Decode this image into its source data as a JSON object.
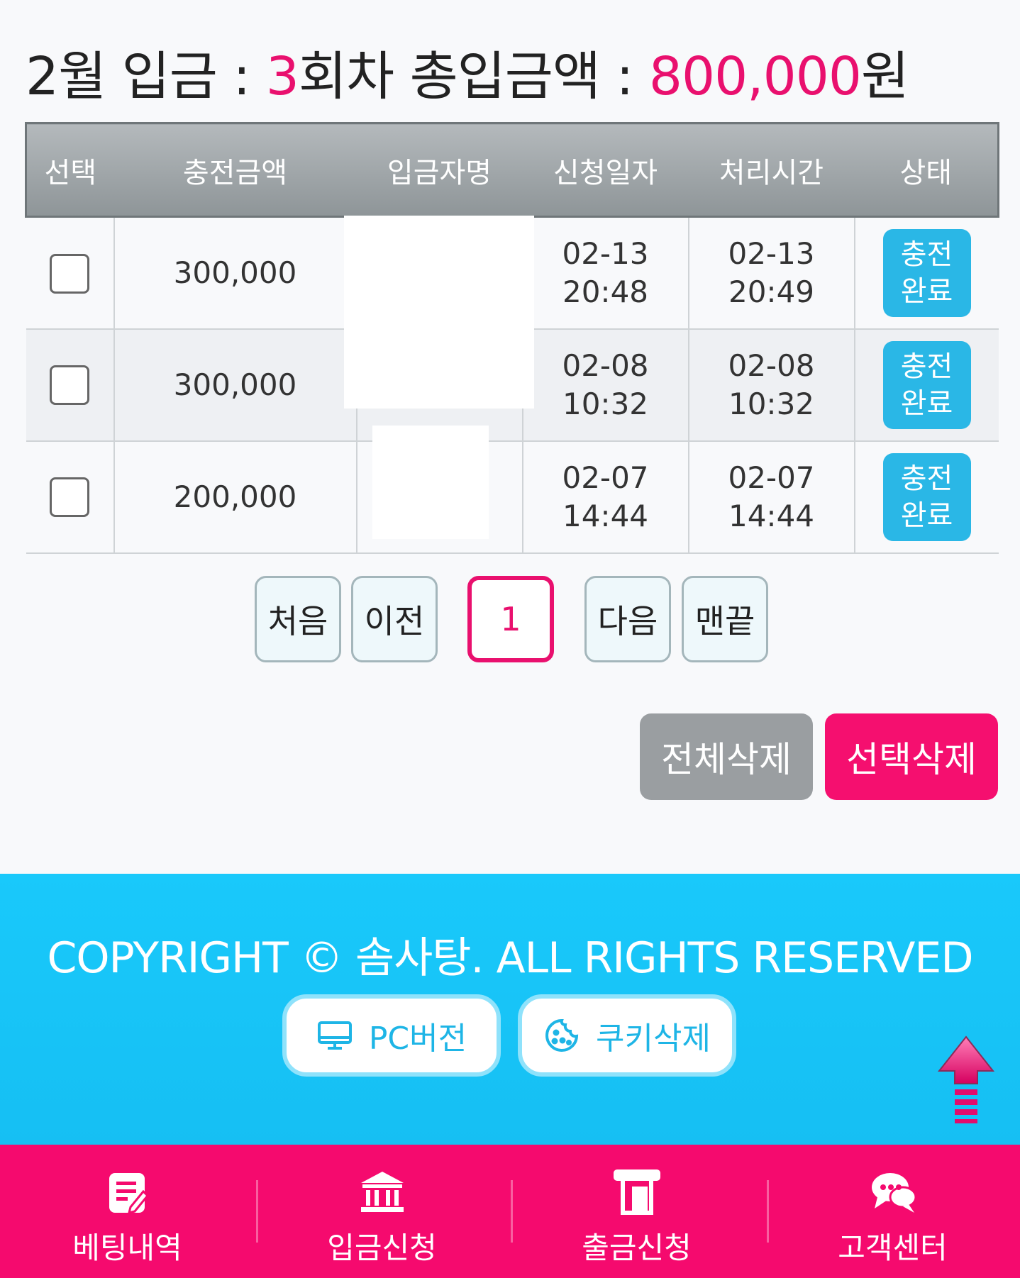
{
  "summary": {
    "prefix": "2월 입금 : ",
    "count": "3",
    "mid": "회차 총입금액 : ",
    "total": "800,000",
    "suffix": "원"
  },
  "table": {
    "headers": [
      "선택",
      "충전금액",
      "입금자명",
      "신청일자",
      "처리시간",
      "상태"
    ],
    "rows": [
      {
        "amount": "300,000",
        "name": "",
        "req_date": "02-13",
        "req_time": "20:48",
        "proc_date": "02-13",
        "proc_time": "20:49",
        "status_l1": "충전",
        "status_l2": "완료"
      },
      {
        "amount": "300,000",
        "name": "",
        "req_date": "02-08",
        "req_time": "10:32",
        "proc_date": "02-08",
        "proc_time": "10:32",
        "status_l1": "충전",
        "status_l2": "완료"
      },
      {
        "amount": "200,000",
        "name": "",
        "req_date": "02-07",
        "req_time": "14:44",
        "proc_date": "02-07",
        "proc_time": "14:44",
        "status_l1": "충전",
        "status_l2": "완료"
      }
    ]
  },
  "pager": {
    "first": "처음",
    "prev": "이전",
    "current": "1",
    "next": "다음",
    "last": "맨끝"
  },
  "actions": {
    "delete_all": "전체삭제",
    "delete_selected": "선택삭제"
  },
  "footer": {
    "copyright": "COPYRIGHT © 솜사탕. ALL RIGHTS RESERVED",
    "pc_version": "PC버전",
    "cookie_delete": "쿠키삭제"
  },
  "bottom_nav": {
    "betting": "베팅내역",
    "deposit": "입금신청",
    "withdraw": "출금신청",
    "support": "고객센터"
  },
  "colors": {
    "accent": "#e9106e",
    "status": "#2ab7e6",
    "footer": "#19c9fb",
    "nav": "#f50a6e"
  }
}
